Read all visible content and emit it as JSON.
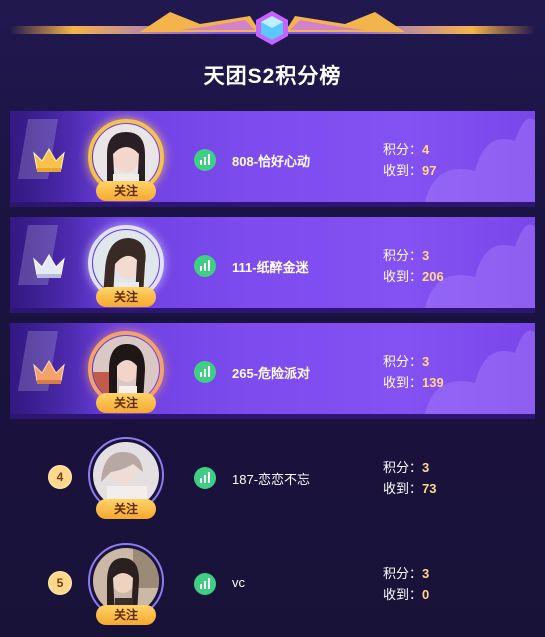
{
  "header": {
    "title": "天团S2积分榜"
  },
  "labels": {
    "score": "积分：",
    "received": "收到："
  },
  "rows": [
    {
      "rank": "1",
      "name": "808-恰好心动",
      "score": "4",
      "received": "97",
      "follow": "关注"
    },
    {
      "rank": "2",
      "name": "111-纸醉金迷",
      "score": "3",
      "received": "206",
      "follow": "关注"
    },
    {
      "rank": "3",
      "name": "265-危险派对",
      "score": "3",
      "received": "139",
      "follow": "关注"
    },
    {
      "rank": "4",
      "name": "187-恋恋不忘",
      "score": "3",
      "received": "73",
      "follow": "关注"
    },
    {
      "rank": "5",
      "name": "vc",
      "score": "3",
      "received": "0",
      "follow": "关注"
    }
  ],
  "colors": {
    "accent": "#7d4bee",
    "gold": "#f6c24a",
    "silver": "#dfe2f5",
    "bronze": "#f3a36a",
    "signal": "#3fcf84",
    "value": "#ffd88a"
  },
  "icons": {
    "crown": "crown-icon",
    "signal": "signal-bars-icon"
  }
}
